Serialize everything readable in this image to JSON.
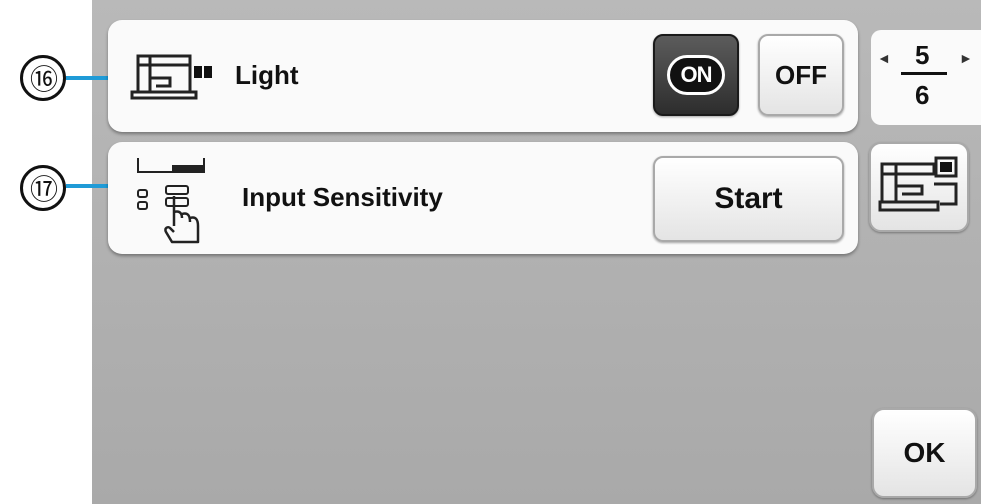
{
  "callouts": {
    "light": "⑯",
    "sensitivity": "⑰"
  },
  "light": {
    "label": "Light",
    "on_label": "ON",
    "off_label": "OFF",
    "state": "on"
  },
  "sensitivity": {
    "label": "Input Sensitivity",
    "start_label": "Start"
  },
  "pager": {
    "current": "5",
    "total": "6",
    "prev_glyph": "◄",
    "next_glyph": "►"
  },
  "ok_label": "OK",
  "icons": {
    "light": "machine-light-icon",
    "sensitivity": "touch-sensitivity-icon",
    "embroidery": "embroidery-machine-icon"
  },
  "colors": {
    "callout_line": "#1f9bd7",
    "screen_bg": "#b0b0b0",
    "on_bg": "#111111"
  }
}
